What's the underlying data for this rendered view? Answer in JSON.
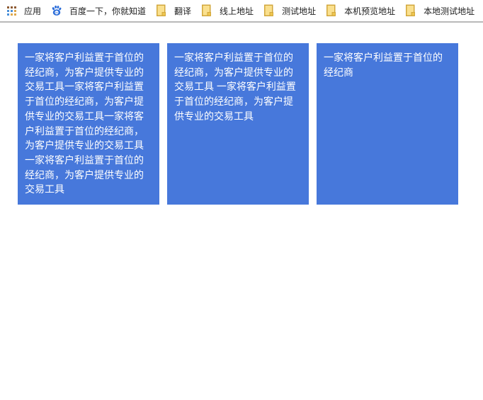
{
  "bookmarks_bar": {
    "items": [
      {
        "label": "应用",
        "icon": "apps-grid-icon"
      },
      {
        "label": "百度一下，你就知道",
        "icon": "baidu-paw-icon"
      },
      {
        "label": "翻译",
        "icon": "bookmark-folder-icon"
      },
      {
        "label": "线上地址",
        "icon": "bookmark-folder-icon"
      },
      {
        "label": "测试地址",
        "icon": "bookmark-folder-icon"
      },
      {
        "label": "本机预览地址",
        "icon": "bookmark-folder-icon"
      },
      {
        "label": "本地测试地址",
        "icon": "bookmark-folder-icon"
      }
    ]
  },
  "cards": [
    {
      "text": "一家将客户利益置于首位的经纪商，为客户提供专业的交易工具一家将客户利益置于首位的经纪商，为客户提供专业的交易工具一家将客户利益置于首位的经纪商，为客户提供专业的交易工具一家将客户利益置于首位的经纪商，为客户提供专业的交易工具",
      "lines": [
        "一家将客户利益置于首位的",
        "经纪商，为客户提供专业的",
        "交易工具一家将客户利益置",
        "于首位的经纪商，为客户提",
        "供专业的交易工具一家将客",
        "户利益置于首位的经纪商，",
        "为客户提供专业的交易工具",
        "一家将客户利益置于首位的",
        "经纪商，为客户提供专业的",
        "交易工具"
      ]
    },
    {
      "text": "一家将客户利益置于首位的经纪商，为客户提供专业的交易工具 一家将客户利益置于首位的经纪商，为客户提供专业的交易工具",
      "lines": [
        "一家将客户利益置于首位的",
        "经纪商，为客户提供专业的",
        "交易工具 一家将客户利益置",
        "于首位的经纪商，为客户提",
        "供专业的交易工具"
      ]
    },
    {
      "text": "一家将客户利益置于首位的经纪商",
      "lines": [
        "一家将客户利益置于首位的",
        "经纪商"
      ]
    }
  ],
  "colors": {
    "card_bg": "#4778db",
    "card_text": "#ffffff",
    "toolbar_text": "#202020",
    "toolbar_border": "#b9b9b9",
    "folder_fill": "#fae08e",
    "folder_tab_fill": "#eec64f",
    "folder_border": "#d2a73c",
    "baidu_blue": "#2b6dd9",
    "apps_grid_colors": [
      "#8d5a33",
      "#8d5a33",
      "#8d5a33",
      "#4a90d9",
      "#4a90d9",
      "#dda74b",
      "#4a90d9",
      "#dda74b",
      "#dda74b"
    ]
  }
}
